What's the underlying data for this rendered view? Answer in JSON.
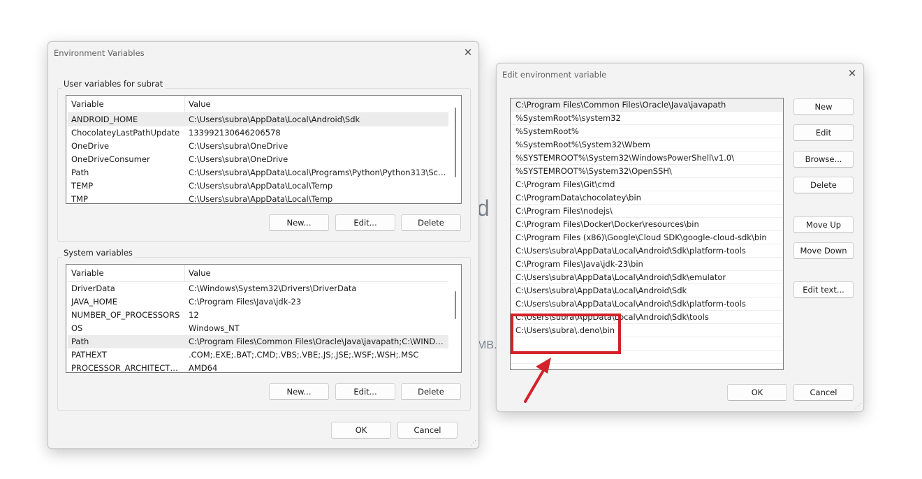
{
  "background": {
    "fragment_d": "d",
    "fragment_mb": "MB."
  },
  "env_dialog": {
    "title": "Environment Variables",
    "user_group_label": "User variables for subrat",
    "columns": [
      "Variable",
      "Value"
    ],
    "user_vars": [
      {
        "name": "ANDROID_HOME",
        "value": "C:\\Users\\subra\\AppData\\Local\\Android\\Sdk"
      },
      {
        "name": "ChocolateyLastPathUpdate",
        "value": "133992130646206578"
      },
      {
        "name": "OneDrive",
        "value": "C:\\Users\\subra\\OneDrive"
      },
      {
        "name": "OneDriveConsumer",
        "value": "C:\\Users\\subra\\OneDrive"
      },
      {
        "name": "Path",
        "value": "C:\\Users\\subra\\AppData\\Local\\Programs\\Python\\Python313\\Script..."
      },
      {
        "name": "TEMP",
        "value": "C:\\Users\\subra\\AppData\\Local\\Temp"
      },
      {
        "name": "TMP",
        "value": "C:\\Users\\subra\\AppData\\Local\\Temp"
      }
    ],
    "system_group_label": "System variables",
    "system_vars": [
      {
        "name": "DriverData",
        "value": "C:\\Windows\\System32\\Drivers\\DriverData"
      },
      {
        "name": "JAVA_HOME",
        "value": "C:\\Program Files\\Java\\jdk-23"
      },
      {
        "name": "NUMBER_OF_PROCESSORS",
        "value": "12"
      },
      {
        "name": "OS",
        "value": "Windows_NT"
      },
      {
        "name": "Path",
        "value": "C:\\Program Files\\Common Files\\Oracle\\Java\\javapath;C:\\WINDOW..."
      },
      {
        "name": "PATHEXT",
        "value": ".COM;.EXE;.BAT;.CMD;.VBS;.VBE;.JS;.JSE;.WSF;.WSH;.MSC"
      },
      {
        "name": "PROCESSOR_ARCHITECTURE",
        "value": "AMD64"
      }
    ],
    "buttons": {
      "new": "New...",
      "edit": "Edit...",
      "delete": "Delete",
      "ok": "OK",
      "cancel": "Cancel"
    }
  },
  "edit_dialog": {
    "title": "Edit environment variable",
    "paths": [
      "C:\\Program Files\\Common Files\\Oracle\\Java\\javapath",
      "%SystemRoot%\\system32",
      "%SystemRoot%",
      "%SystemRoot%\\System32\\Wbem",
      "%SYSTEMROOT%\\System32\\WindowsPowerShell\\v1.0\\",
      "%SYSTEMROOT%\\System32\\OpenSSH\\",
      "C:\\Program Files\\Git\\cmd",
      "C:\\ProgramData\\chocolatey\\bin",
      "C:\\Program Files\\nodejs\\",
      "C:\\Program Files\\Docker\\Docker\\resources\\bin",
      "C:\\Program Files (x86)\\Google\\Cloud SDK\\google-cloud-sdk\\bin",
      "C:\\Users\\subra\\AppData\\Local\\Android\\Sdk\\platform-tools",
      "C:\\Program Files\\Java\\jdk-23\\bin",
      "C:\\Users\\subra\\AppData\\Local\\Android\\Sdk\\emulator",
      "C:\\Users\\subra\\AppData\\Local\\Android\\Sdk",
      "C:\\Users\\subra\\AppData\\Local\\Android\\Sdk\\platform-tools",
      "C:\\Users\\subra\\AppData\\Local\\Android\\Sdk\\tools",
      "C:\\Users\\subra\\.deno\\bin",
      "",
      ""
    ],
    "buttons": {
      "new": "New",
      "edit": "Edit",
      "browse": "Browse...",
      "delete": "Delete",
      "move_up": "Move Up",
      "move_down": "Move Down",
      "edit_text": "Edit text...",
      "ok": "OK",
      "cancel": "Cancel"
    }
  },
  "colors": {
    "annotation": "#d4222a",
    "dialog_bg": "#f3f3f3"
  },
  "icons": {
    "close": "close-icon",
    "resize": "resize-grip-icon",
    "arrow": "annotation-arrow"
  }
}
